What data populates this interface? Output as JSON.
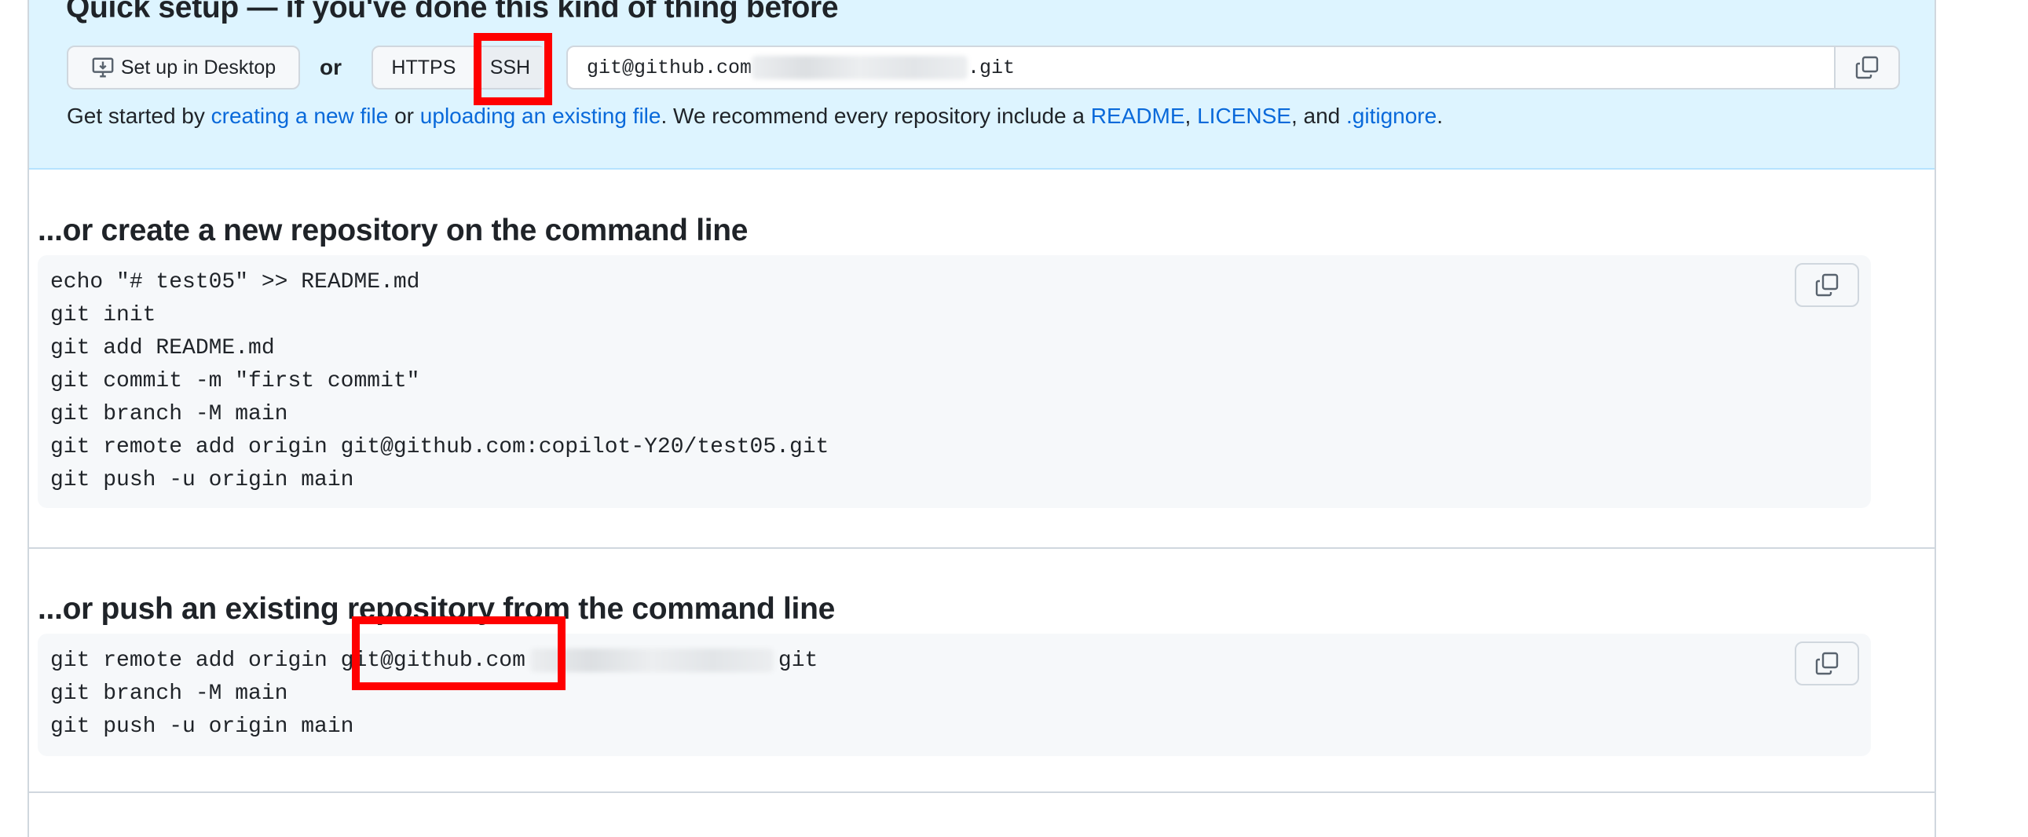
{
  "quick_setup": {
    "title": "Quick setup — if you've done this kind of thing before",
    "desktop_button": "Set up in Desktop",
    "or_label": "or",
    "protocols": [
      "HTTPS",
      "SSH"
    ],
    "selected_protocol": "SSH",
    "url_prefix": "git@github.com",
    "url_suffix": ".git",
    "help": {
      "prefix": "Get started by ",
      "link_new_file": "creating a new file",
      "or": " or ",
      "link_upload": "uploading an existing file",
      "mid": ". We recommend every repository include a ",
      "link_readme": "README",
      "comma1": ", ",
      "link_license": "LICENSE",
      "and": ", and ",
      "link_gitignore": ".gitignore",
      "end": "."
    }
  },
  "create_section": {
    "title": "...or create a new repository on the command line",
    "lines": [
      "echo \"# test05\" >> README.md",
      "git init",
      "git add README.md",
      "git commit -m \"first commit\"",
      "git branch -M main",
      "git remote add origin git@github.com:copilot-Y20/test05.git",
      "git push -u origin main"
    ]
  },
  "push_section": {
    "title": "...or push an existing repository from the command line",
    "line1_prefix": "git remote add origin ",
    "line1_host": "git@github.com",
    "line1_suffix": "git",
    "lines": [
      "git branch -M main",
      "git push -u origin main"
    ]
  },
  "icons": {
    "desktop": "desktop-download-icon",
    "copy": "copy-icon"
  },
  "colors": {
    "link": "#0969da",
    "quick_bg": "#ddf4ff",
    "code_bg": "#f6f8fa",
    "highlight": "#ff0000"
  }
}
